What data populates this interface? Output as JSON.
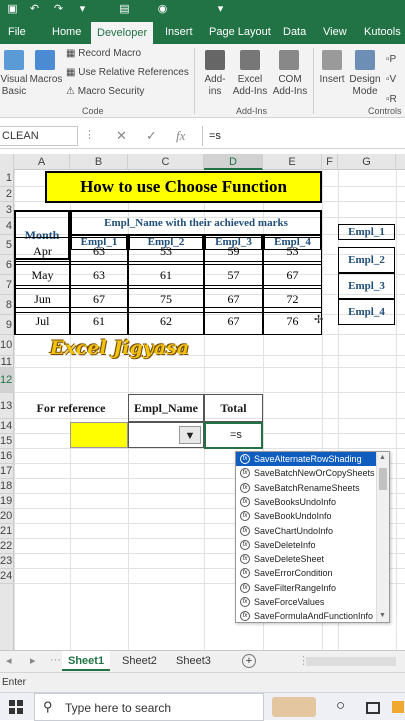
{
  "ribbon_tabs": [
    "File",
    "Home",
    "Developer",
    "Insert",
    "Page Layout",
    "Data",
    "View",
    "Kutools"
  ],
  "ribbon_tabs_overflow": "›",
  "ribbon": {
    "visual_basic": "Visual\nBasic",
    "macros": "Macros",
    "record_macro": "Record Macro",
    "relative_refs": "Use Relative References",
    "macro_security": "Macro Security",
    "group_code": "Code",
    "addins": "Add-\nins",
    "excel_addins": "Excel\nAdd-Ins",
    "com_addins": "COM\nAdd-Ins",
    "group_addins": "Add-Ins",
    "insert": "Insert",
    "design_mode": "Design\nMode",
    "group_controls": "Controls"
  },
  "formula_bar": {
    "name_box": "CLEAN",
    "cancel": "✕",
    "enter": "✓",
    "fx": "fx",
    "value": "=s"
  },
  "columns": [
    "A",
    "B",
    "C",
    "D",
    "E",
    "F",
    "G"
  ],
  "rows": [
    "1",
    "2",
    "3",
    "4",
    "5",
    "6",
    "7",
    "8",
    "9",
    "10",
    "11",
    "12",
    "13",
    "14",
    "15",
    "16",
    "17",
    "18",
    "19",
    "20",
    "21",
    "22",
    "23",
    "24"
  ],
  "sheet": {
    "title": "How to use Choose Function",
    "month_header": "Month",
    "group_header": "Empl_Name with their achieved marks",
    "empl_headers": [
      "Empl_1",
      "Empl_2",
      "Empl_3",
      "Empl_4"
    ],
    "months": [
      "Apr",
      "May",
      "Jun",
      "Jul"
    ],
    "marks": [
      [
        63,
        53,
        59,
        53
      ],
      [
        63,
        61,
        57,
        67
      ],
      [
        67,
        75,
        67,
        72
      ],
      [
        61,
        62,
        67,
        76
      ]
    ],
    "side_list": [
      "Empl_1",
      "Empl_2",
      "Empl_3",
      "Empl_4"
    ],
    "watermark": "Excel Jigyasa",
    "ref_headers": [
      "For reference",
      "Empl_Name",
      "Total"
    ],
    "active_cell_value": "=s"
  },
  "autocomplete": [
    "SaveAlternateRowShading",
    "SaveBatchNewOrCopySheets",
    "SaveBatchRenameSheets",
    "SaveBooksUndoInfo",
    "SaveBookUndoInfo",
    "SaveChartUndoInfo",
    "SaveDeleteInfo",
    "SaveDeleteSheet",
    "SaveErrorCondition",
    "SaveFilterRangeInfo",
    "SaveForceValues",
    "SaveFormulaAndFunctionInfo"
  ],
  "sheet_tabs": [
    "Sheet1",
    "Sheet2",
    "Sheet3"
  ],
  "add_sheet": "+",
  "status_mode": "Enter",
  "taskbar_search": "Type here to search",
  "colors": {
    "excel_green": "#217346",
    "title_fill": "#ffff00",
    "header_text": "#1f4e79",
    "highlight": "#0e5dbf"
  }
}
